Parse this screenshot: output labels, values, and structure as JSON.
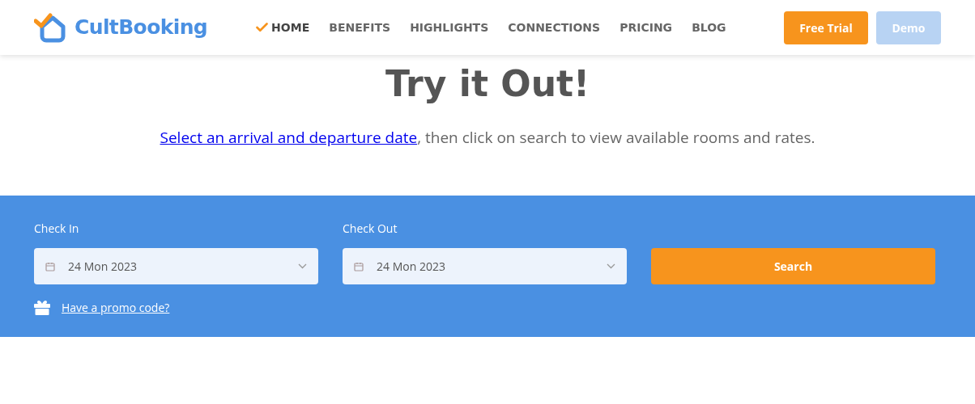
{
  "header": {
    "logo": "CultBooking",
    "nav": [
      {
        "label": "HOME",
        "selected": true
      },
      {
        "label": "BENEFITS",
        "selected": false
      },
      {
        "label": "HIGHLIGHTS",
        "selected": false
      },
      {
        "label": "CONNECTIONS",
        "selected": false
      },
      {
        "label": "PRICING",
        "selected": false
      },
      {
        "label": "BLOG",
        "selected": false
      }
    ],
    "buttons": [
      {
        "label": "Free Trial",
        "disabled": false
      },
      {
        "label": "Demo",
        "disabled": true
      }
    ]
  },
  "hero": {
    "title": "Try it Out!",
    "link": "Select an arrival and departure date",
    "text": ", then click on search to view available rooms and rates."
  },
  "search": {
    "fields": [
      {
        "label": "Check In",
        "value": "24 Mon 2023"
      },
      {
        "label": "Check Out",
        "value": "24 Mon 2023"
      }
    ],
    "button": "Search",
    "promo": "Have a promo code?"
  }
}
